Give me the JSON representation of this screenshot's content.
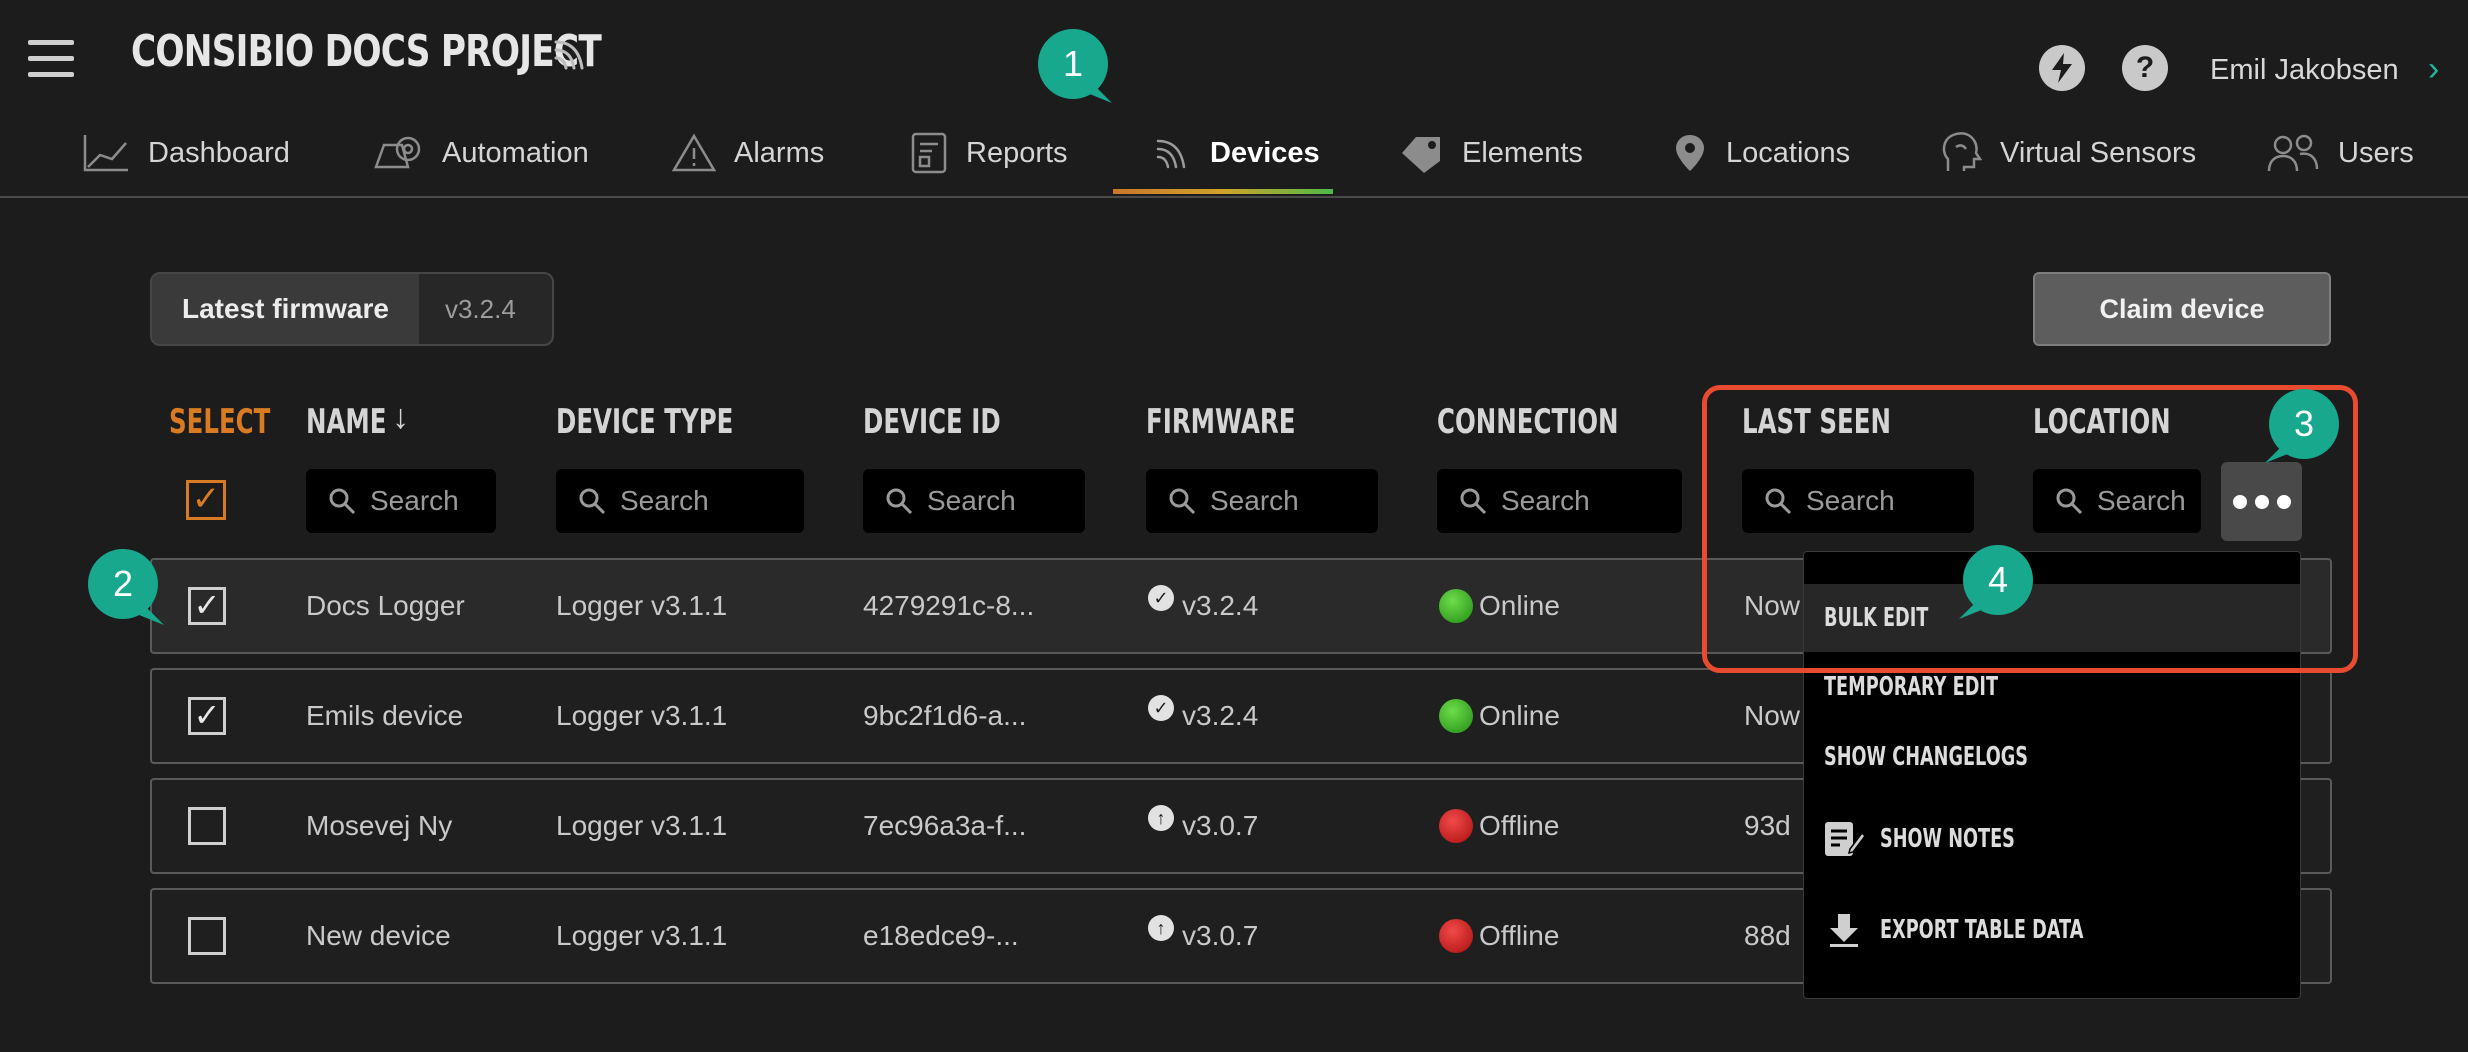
{
  "header": {
    "project_title": "CONSIBIO DOCS PROJECT",
    "user_name": "Emil Jakobsen",
    "chevron": "›"
  },
  "nav": {
    "items": [
      {
        "label": "Dashboard",
        "icon": "chart-line-icon"
      },
      {
        "label": "Automation",
        "icon": "automation-icon"
      },
      {
        "label": "Alarms",
        "icon": "warning-triangle-icon"
      },
      {
        "label": "Reports",
        "icon": "report-icon"
      },
      {
        "label": "Devices",
        "icon": "wireless-icon",
        "active": true
      },
      {
        "label": "Elements",
        "icon": "tag-icon"
      },
      {
        "label": "Locations",
        "icon": "location-pin-icon"
      },
      {
        "label": "Virtual Sensors",
        "icon": "virtual-sensor-icon"
      },
      {
        "label": "Users",
        "icon": "users-icon"
      }
    ]
  },
  "toolbar": {
    "firmware_label": "Latest firmware",
    "firmware_value": "v3.2.4",
    "claim_button": "Claim device"
  },
  "table": {
    "columns": [
      "SELECT",
      "NAME",
      "DEVICE TYPE",
      "DEVICE ID",
      "FIRMWARE",
      "CONNECTION",
      "LAST SEEN",
      "LOCATION"
    ],
    "sort_indicator": "↓",
    "search_placeholder": "Search",
    "location_search_placeholder": "Search",
    "rows": [
      {
        "checked": true,
        "name": "Docs Logger",
        "device_type": "Logger v3.1.1",
        "device_id": "4279291c-8...",
        "firmware": "v3.2.4",
        "firmware_status": "up-to-date",
        "connection": "Online",
        "last_seen": "Now"
      },
      {
        "checked": true,
        "name": "Emils device",
        "device_type": "Logger v3.1.1",
        "device_id": "9bc2f1d6-a...",
        "firmware": "v3.2.4",
        "firmware_status": "up-to-date",
        "connection": "Online",
        "last_seen": "Now"
      },
      {
        "checked": false,
        "name": "Mosevej Ny",
        "device_type": "Logger v3.1.1",
        "device_id": "7ec96a3a-f...",
        "firmware": "v3.0.7",
        "firmware_status": "update-available",
        "connection": "Offline",
        "last_seen": "93d"
      },
      {
        "checked": false,
        "name": "New device",
        "device_type": "Logger v3.1.1",
        "device_id": "e18edce9-...",
        "firmware": "v3.0.7",
        "firmware_status": "update-available",
        "connection": "Offline",
        "last_seen": "88d"
      }
    ]
  },
  "menu": {
    "items": [
      "BULK EDIT",
      "TEMPORARY EDIT",
      "SHOW CHANGELOGS",
      "SHOW NOTES",
      "EXPORT TABLE DATA"
    ]
  },
  "callouts": [
    "1",
    "2",
    "3",
    "4"
  ],
  "colors": {
    "accent": "#17a88e",
    "select_orange": "#d97b22",
    "highlight_red": "#e84b2f",
    "online": "#3cc12a",
    "offline": "#d41a1a"
  }
}
